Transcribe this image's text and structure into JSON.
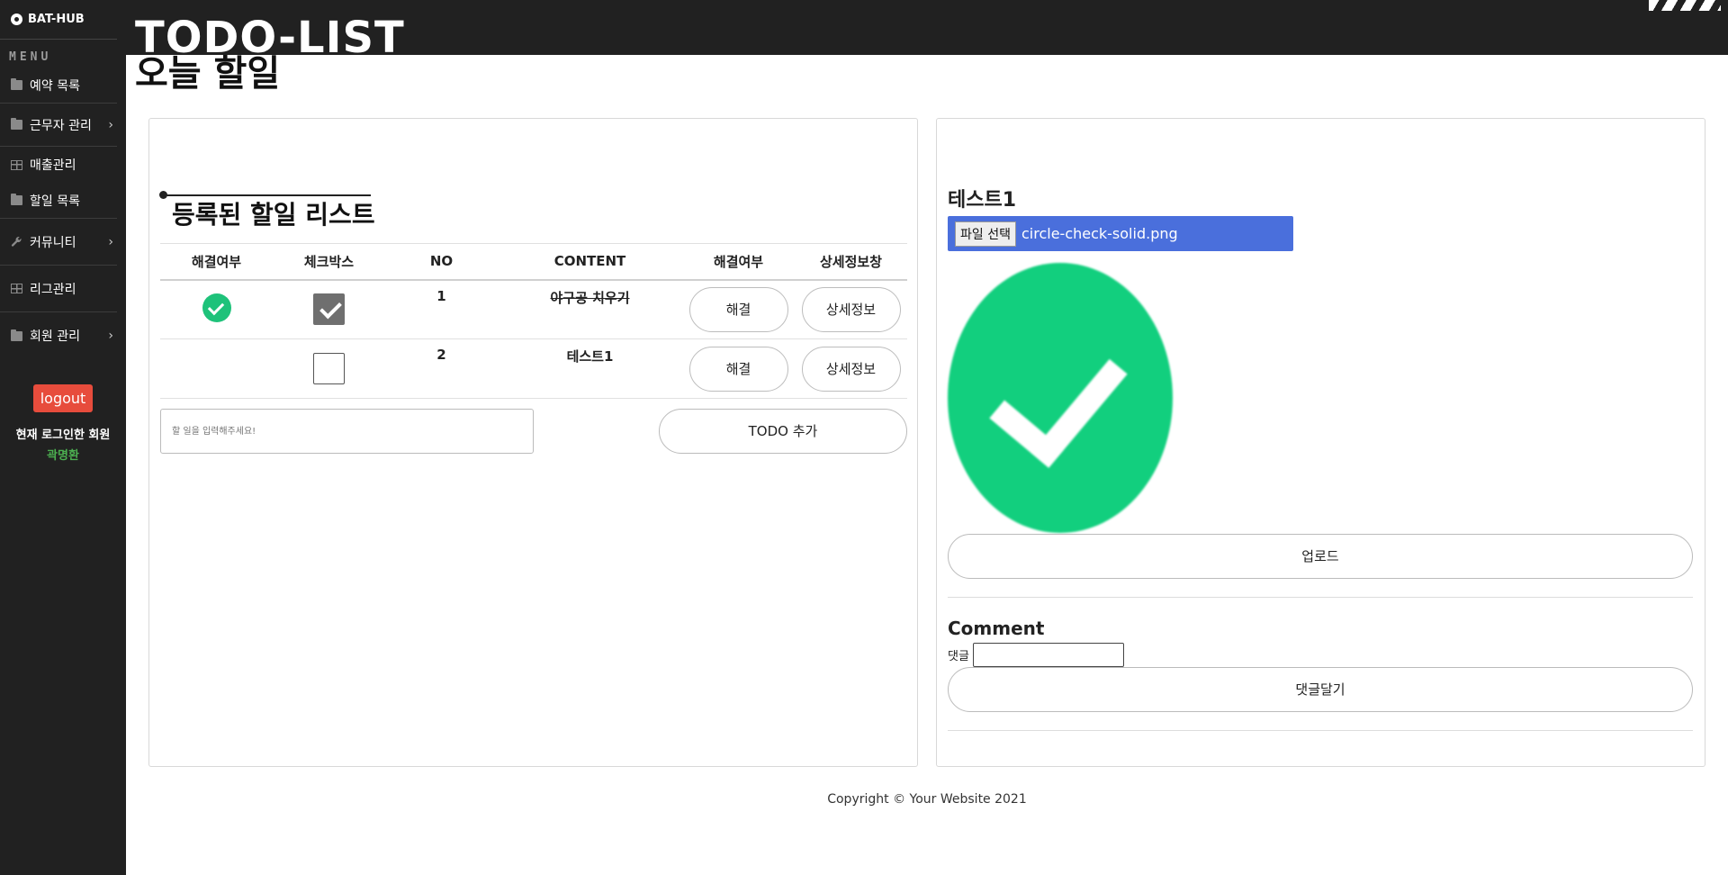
{
  "brand": "BAT-HUB",
  "menu_heading": "MENU",
  "nav": [
    {
      "label": "예약 목록",
      "icon": "folder-icon"
    },
    {
      "label": "근무자 관리",
      "icon": "folder-icon"
    },
    {
      "label": "매출관리",
      "icon": "table-icon"
    },
    {
      "label": "할일 목록",
      "icon": "folder-icon"
    },
    {
      "label": "커뮤니티",
      "icon": "wrench-icon"
    },
    {
      "label": "리그관리",
      "icon": "table-icon"
    },
    {
      "label": "회원 관리",
      "icon": "folder-icon"
    }
  ],
  "logout_label": "logout",
  "login_label": "현재 로그인한 회원",
  "login_name": "곽명환",
  "page_title": "TODO-LIST",
  "page_subtitle": "오늘 할일",
  "list_title": "등록된 할일 리스트",
  "table": {
    "headers": [
      "해결여부",
      "체크박스",
      "NO",
      "CONTENT",
      "해결여부",
      "상세정보창"
    ],
    "rows": [
      {
        "no": "1",
        "content": "야구공 치우기",
        "resolved": true,
        "checked": true,
        "resolve_label": "해결",
        "detail_label": "상세정보"
      },
      {
        "no": "2",
        "content": "테스트1",
        "resolved": false,
        "checked": false,
        "resolve_label": "해결",
        "detail_label": "상세정보"
      }
    ]
  },
  "todo_input_placeholder": "할 일을 입력해주세요!",
  "add_button": "TODO 추가",
  "detail": {
    "title": "테스트1",
    "file_button": "파일 선택",
    "file_name": "circle-check-solid.png",
    "upload_button": "업로드",
    "comment_title": "Comment",
    "comment_label": "댓글",
    "comment_button": "댓글달기"
  },
  "footer": "Copyright © Your Website 2021",
  "colors": {
    "sidebar": "#212121",
    "logout": "#e74c3c",
    "login_name": "#4caf50",
    "success": "#1ec27a",
    "file_bar": "#4a6fdc"
  }
}
